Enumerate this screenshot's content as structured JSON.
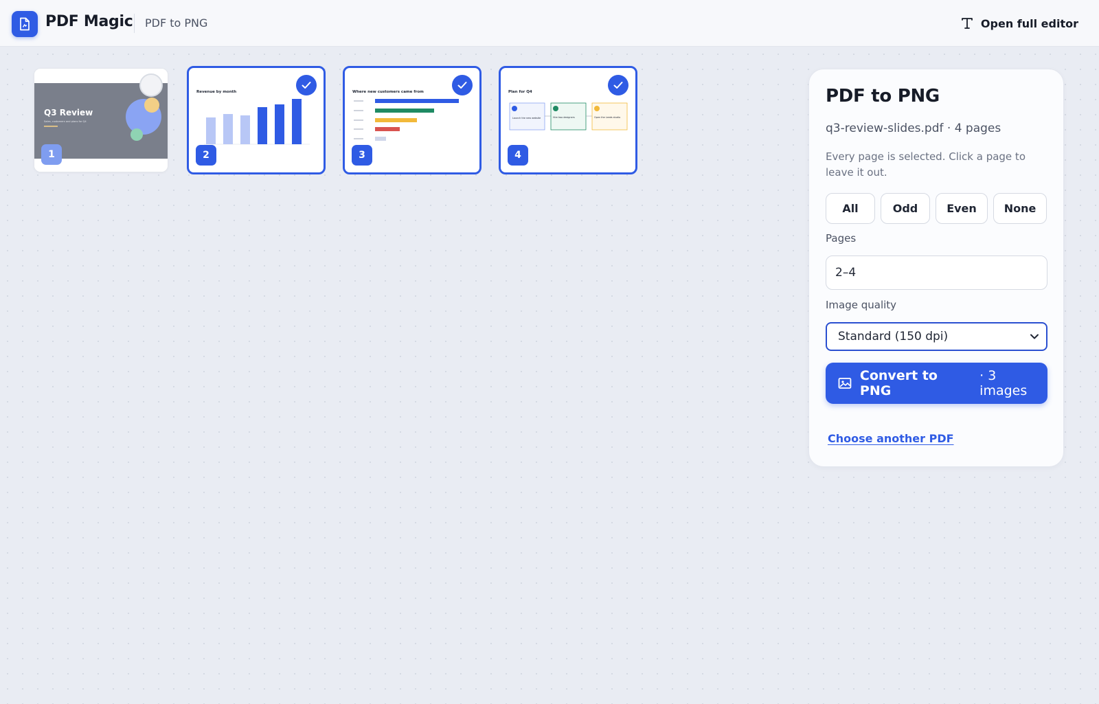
{
  "header": {
    "app_name": "PDF Magic",
    "breadcrumb": "PDF to PNG",
    "editor_link_label": "Open full editor",
    "logo_icon": "pdf-file-icon",
    "editor_icon": "text-tool-icon"
  },
  "pages": [
    {
      "number": "1",
      "selected": false,
      "title": "Q3 Review",
      "subtitle": "Sales, customers and plans for Q4"
    },
    {
      "number": "2",
      "selected": true,
      "title": "Revenue by month"
    },
    {
      "number": "3",
      "selected": true,
      "title": "Where new customers came from"
    },
    {
      "number": "4",
      "selected": true,
      "title": "Plan for Q4",
      "steps": [
        "Launch the new website",
        "Hire two designers",
        "Open the Leeds studio"
      ]
    }
  ],
  "panel": {
    "title": "PDF to PNG",
    "file_info": "q3-review-slides.pdf · 4 pages",
    "hint": "Every page is selected. Click a page to leave it out.",
    "quick_select": [
      "All",
      "Odd",
      "Even",
      "None"
    ],
    "pages_label": "Pages",
    "pages_value": "2–4",
    "quality_label": "Image quality",
    "quality_value": "Standard (150 dpi)",
    "convert_label": "Convert to PNG",
    "convert_count": "· 3 images",
    "convert_icon": "image-icon",
    "choose_link": "Choose another PDF"
  },
  "colors": {
    "accent": "#2f5be4",
    "background": "#e9ecf3"
  }
}
